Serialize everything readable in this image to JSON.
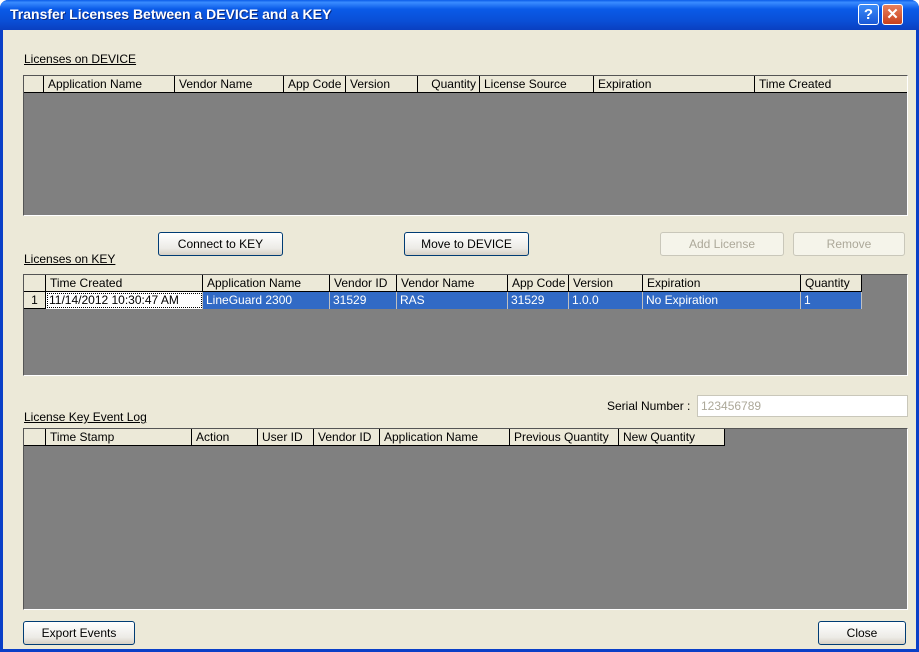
{
  "window": {
    "title": "Transfer Licenses Between a DEVICE and a KEY",
    "help_icon": "?",
    "close_icon": "✕"
  },
  "device": {
    "label": "Licenses on DEVICE",
    "columns": [
      "Application Name",
      "Vendor Name",
      "App Code",
      "Version",
      "Quantity",
      "License Source",
      "Expiration",
      "Time Created"
    ]
  },
  "buttons": {
    "connect": "Connect to KEY",
    "move": "Move to DEVICE",
    "add": "Add License",
    "remove": "Remove",
    "export": "Export Events",
    "close": "Close"
  },
  "key": {
    "label": "Licenses on KEY",
    "columns": [
      "Time Created",
      "Application Name",
      "Vendor ID",
      "Vendor Name",
      "App Code",
      "Version",
      "Expiration",
      "Quantity"
    ],
    "rows": [
      {
        "num": "1",
        "cells": [
          "11/14/2012 10:30:47 AM",
          "LineGuard 2300",
          "31529",
          "RAS",
          "31529",
          "1.0.0",
          "No Expiration",
          "1"
        ]
      }
    ]
  },
  "serial": {
    "label": "Serial Number :",
    "value": "123456789"
  },
  "log": {
    "label": "License Key Event Log",
    "columns": [
      "Time Stamp",
      "Action",
      "User ID",
      "Vendor ID",
      "Application Name",
      "Previous Quantity",
      "New Quantity"
    ]
  },
  "colors": {
    "selection": "#316AC5",
    "grid_bg": "#808080",
    "dialog_bg": "#ECE9D8",
    "title_blue": "#0A5BE8"
  }
}
